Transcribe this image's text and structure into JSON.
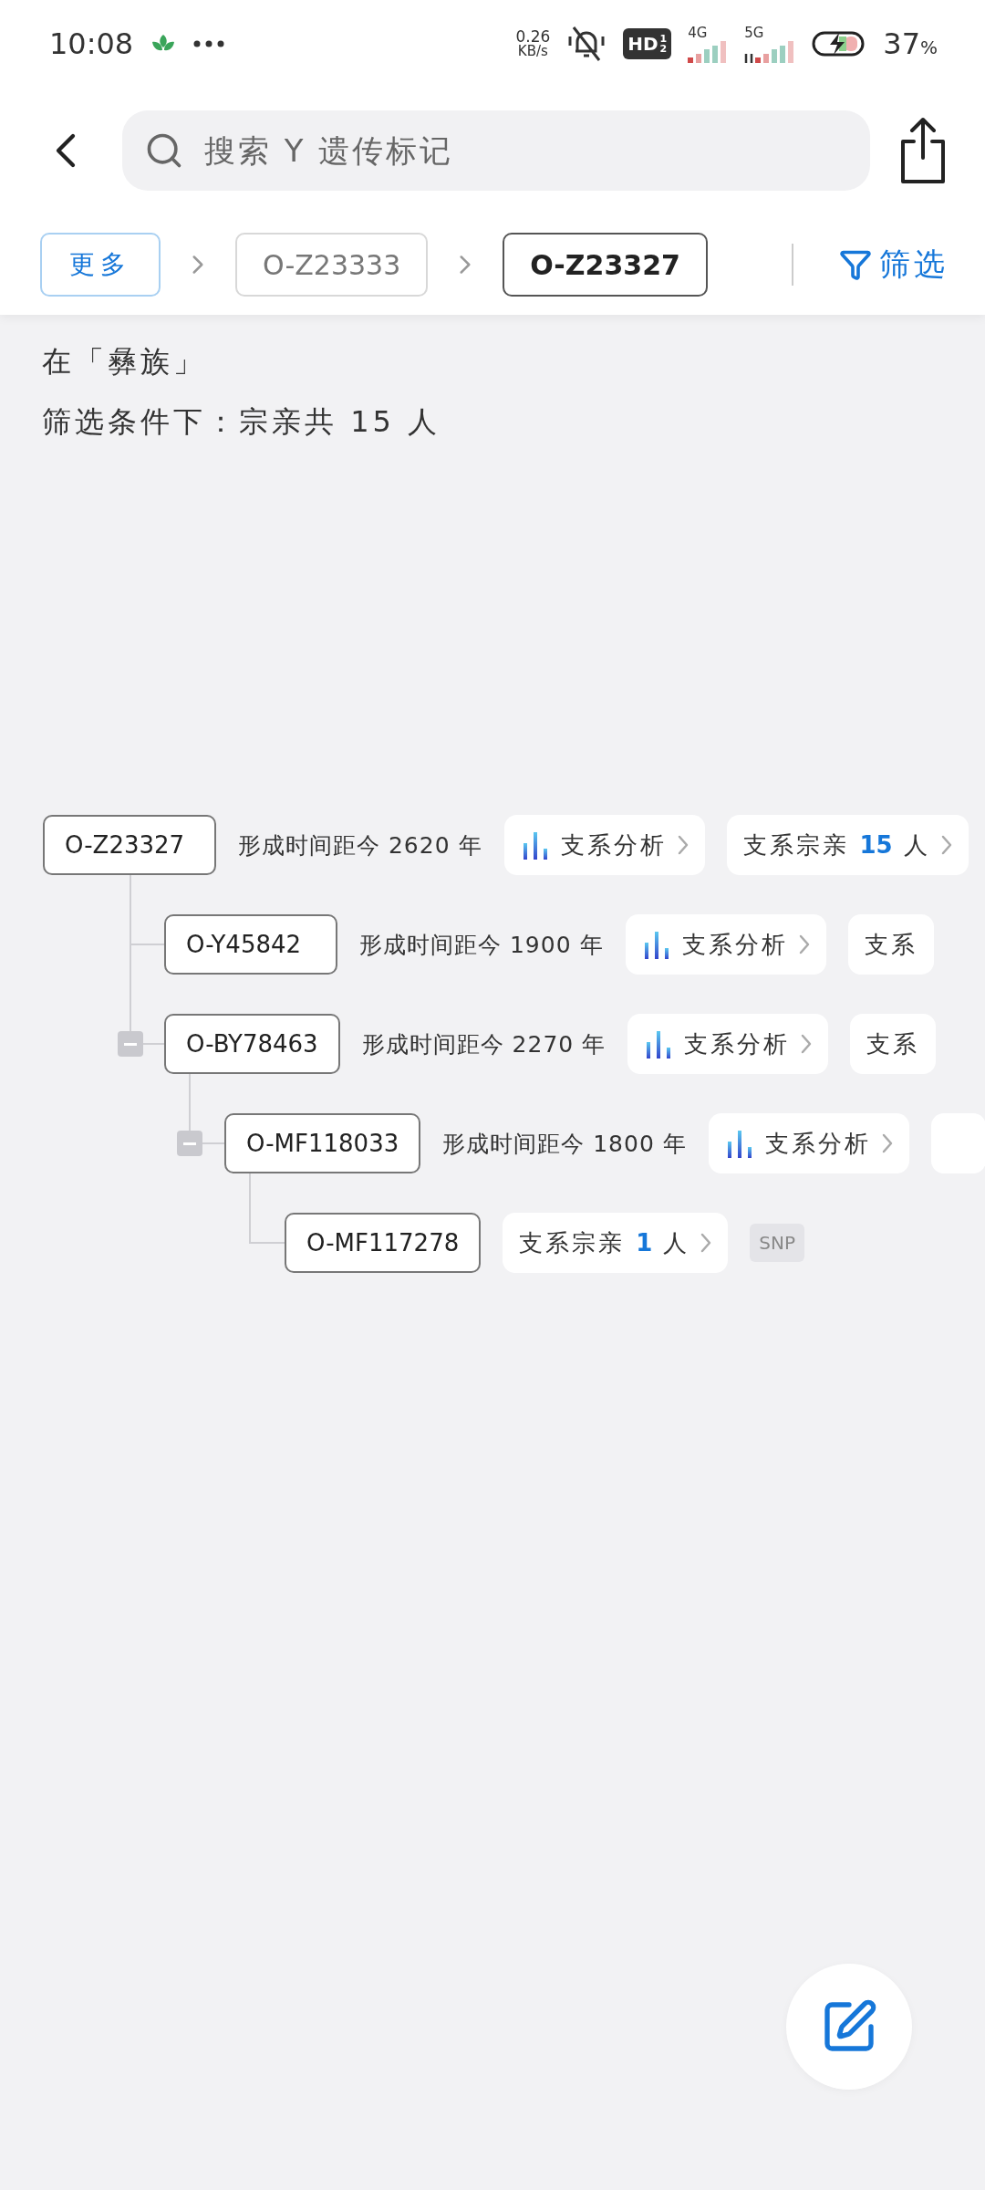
{
  "status_bar": {
    "time": "10:08",
    "net_speed": "0.26",
    "net_unit": "KB/s",
    "hd": "HD",
    "hd_sup": "1",
    "hd_sub": "2",
    "sim1": "4G",
    "sim2": "5G",
    "battery": "37",
    "battery_unit": "%"
  },
  "search": {
    "placeholder": "搜索 Y 遗传标记"
  },
  "breadcrumb": [
    {
      "label": "更多",
      "kind": "more",
      "selected": false
    },
    {
      "label": "O-Z23333",
      "kind": "node",
      "selected": false
    },
    {
      "label": "O-Z23327",
      "kind": "node",
      "selected": true
    }
  ],
  "filter": {
    "label": "筛选"
  },
  "summary": {
    "line_1": "在「彝族」",
    "line_2": "筛选条件下：宗亲共 15 人"
  },
  "tree": [
    {
      "label": "O-Z23327",
      "time": "形成时间距今 2620 年",
      "collapse_button": false,
      "chips": [
        {
          "kind": "analysis",
          "label": "支系分析"
        },
        {
          "kind": "relatives",
          "prefix": "支系宗亲",
          "count": "15",
          "suffix": "人"
        }
      ],
      "children": [
        {
          "label": "O-Y45842",
          "time": "形成时间距今 1900 年",
          "collapse_button": false,
          "chips": [
            {
              "kind": "analysis",
              "label": "支系分析"
            },
            {
              "kind": "relatives",
              "prefix": "支系"
            }
          ]
        },
        {
          "label": "O-BY78463",
          "time": "形成时间距今 2270 年",
          "collapse_button": true,
          "chips": [
            {
              "kind": "analysis",
              "label": "支系分析"
            },
            {
              "kind": "relatives",
              "prefix": "支系"
            }
          ],
          "children": [
            {
              "label": "O-MF118033",
              "time": "形成时间距今 1800 年",
              "collapse_button": true,
              "chips": [
                {
                  "kind": "analysis",
                  "label": "支系分析"
                },
                {
                  "kind": "relatives"
                }
              ],
              "children": [
                {
                  "label": "O-MF117278",
                  "collapse_button": false,
                  "chips": [
                    {
                      "kind": "relatives",
                      "prefix": "支系宗亲",
                      "count": "1",
                      "suffix": "人"
                    },
                    {
                      "kind": "tag",
                      "label": "SNP"
                    }
                  ]
                }
              ]
            }
          ]
        }
      ]
    }
  ]
}
